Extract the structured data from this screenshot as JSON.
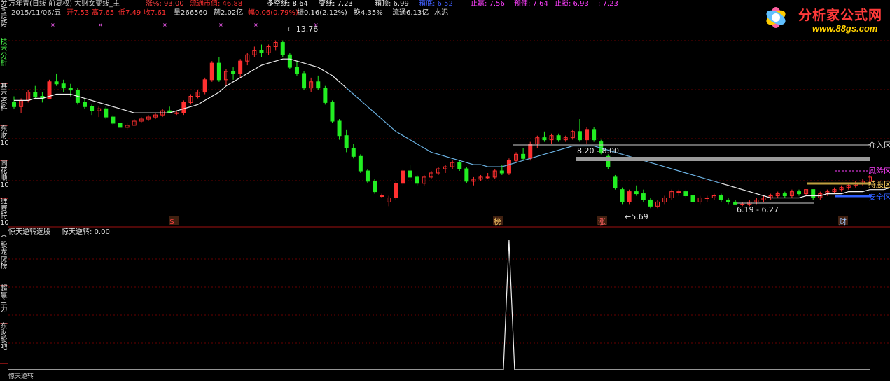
{
  "sidebar": {
    "tabs": [
      {
        "label": "分时走势",
        "active": false
      },
      {
        "label": "技术分析",
        "active": true
      },
      {
        "label": "基本资料",
        "active": false
      },
      {
        "label": "东财10",
        "active": false
      },
      {
        "label": "同花顺10",
        "active": false
      },
      {
        "label": "维赛特10",
        "active": false
      },
      {
        "label": "个股龙虎榜",
        "active": false
      },
      {
        "label": "超赢主力",
        "active": false
      },
      {
        "label": "东财股吧",
        "active": false
      }
    ]
  },
  "header": {
    "title": "万年青(日线 前复权) 大财女变线_主",
    "zhangpct": "涨%: 93.00",
    "liutong_value": "流通市值: 46.88",
    "duokong": "多空线: 8.64",
    "bianxian": "变线: 7.23",
    "xiangding": "箱顶: 6.99",
    "xiangdi": "箱底: 6.52",
    "zhiying": "止赢: 7.56",
    "yuli": "预俚: 7.64",
    "zhisun": "止损: 6.93",
    "extra": ": 7.23"
  },
  "info_row": {
    "date": "2015/11/06/五",
    "open": "开7.53",
    "high": "高7.65",
    "low": "低7.49",
    "close": "收7.61",
    "volume": "量266560",
    "amount": "额2.02亿",
    "change": "幅0.06(0.79%)",
    "amplitude": "振0.16(2.12%)",
    "turnover": "换4.35%",
    "float_cap": "流通6.13亿",
    "sector": "水泥"
  },
  "annotations": {
    "peak_label": "13.76",
    "box_label": "8.20 - 8.00",
    "low_label": "5.69",
    "range_label": "6.19 - 6.27",
    "entry": "介入区",
    "risk": "风险区",
    "hold": "持股区",
    "safe": "安全区"
  },
  "event_markers": [
    {
      "text": "$",
      "color": "#ff4040"
    },
    {
      "text": "榜",
      "color": "#f0c060"
    },
    {
      "text": "涨",
      "color": "#ff6060"
    },
    {
      "text": "财",
      "color": "#a0c8ff"
    }
  ],
  "sub_panel": {
    "title": "惊天逆转选股",
    "indicator": "惊天逆转: 0.00",
    "bottom_text": "惊天逆转"
  },
  "logo": {
    "title": "分析家公式网",
    "url": "www.88gs.com"
  },
  "colors": {
    "up": "#ff3030",
    "down": "#22ee22",
    "grid": "#6a0000",
    "ma": "#f0f0f0",
    "ma_cool": "#6ab0e0"
  },
  "chart_data": {
    "type": "candlestick",
    "candles": [
      {
        "o": 10.8,
        "h": 11.1,
        "l": 10.5,
        "c": 10.6
      },
      {
        "o": 10.6,
        "h": 11.0,
        "l": 10.3,
        "c": 10.9
      },
      {
        "o": 10.9,
        "h": 11.4,
        "l": 10.8,
        "c": 11.3
      },
      {
        "o": 11.3,
        "h": 11.6,
        "l": 11.0,
        "c": 11.1
      },
      {
        "o": 11.1,
        "h": 11.3,
        "l": 10.8,
        "c": 11.0
      },
      {
        "o": 11.0,
        "h": 11.9,
        "l": 11.0,
        "c": 11.8
      },
      {
        "o": 11.8,
        "h": 12.2,
        "l": 11.6,
        "c": 11.7
      },
      {
        "o": 11.7,
        "h": 11.9,
        "l": 11.3,
        "c": 11.5
      },
      {
        "o": 11.5,
        "h": 11.7,
        "l": 11.1,
        "c": 11.4
      },
      {
        "o": 11.4,
        "h": 11.5,
        "l": 10.7,
        "c": 10.8
      },
      {
        "o": 10.8,
        "h": 11.0,
        "l": 10.5,
        "c": 10.6
      },
      {
        "o": 10.6,
        "h": 10.7,
        "l": 10.2,
        "c": 10.4
      },
      {
        "o": 10.4,
        "h": 10.6,
        "l": 10.1,
        "c": 10.5
      },
      {
        "o": 10.5,
        "h": 10.6,
        "l": 10.0,
        "c": 10.1
      },
      {
        "o": 10.1,
        "h": 10.2,
        "l": 9.7,
        "c": 9.8
      },
      {
        "o": 9.8,
        "h": 9.9,
        "l": 9.5,
        "c": 9.6
      },
      {
        "o": 9.6,
        "h": 9.8,
        "l": 9.5,
        "c": 9.7
      },
      {
        "o": 9.7,
        "h": 10.0,
        "l": 9.7,
        "c": 9.9
      },
      {
        "o": 9.9,
        "h": 10.1,
        "l": 9.8,
        "c": 10.0
      },
      {
        "o": 10.0,
        "h": 10.2,
        "l": 9.9,
        "c": 10.1
      },
      {
        "o": 10.1,
        "h": 10.3,
        "l": 10.0,
        "c": 10.2
      },
      {
        "o": 10.2,
        "h": 10.5,
        "l": 10.1,
        "c": 10.4
      },
      {
        "o": 10.4,
        "h": 10.6,
        "l": 10.3,
        "c": 10.3
      },
      {
        "o": 10.3,
        "h": 10.4,
        "l": 10.2,
        "c": 10.3
      },
      {
        "o": 10.3,
        "h": 10.9,
        "l": 10.2,
        "c": 10.8
      },
      {
        "o": 10.8,
        "h": 11.2,
        "l": 10.7,
        "c": 11.1
      },
      {
        "o": 11.1,
        "h": 11.4,
        "l": 11.0,
        "c": 11.3
      },
      {
        "o": 11.3,
        "h": 12.0,
        "l": 11.2,
        "c": 11.9
      },
      {
        "o": 11.9,
        "h": 12.8,
        "l": 11.8,
        "c": 12.7
      },
      {
        "o": 12.7,
        "h": 13.0,
        "l": 11.8,
        "c": 11.9
      },
      {
        "o": 11.9,
        "h": 12.4,
        "l": 11.6,
        "c": 12.3
      },
      {
        "o": 12.3,
        "h": 12.5,
        "l": 11.9,
        "c": 12.2
      },
      {
        "o": 12.2,
        "h": 12.9,
        "l": 12.0,
        "c": 12.8
      },
      {
        "o": 12.8,
        "h": 13.2,
        "l": 12.6,
        "c": 13.1
      },
      {
        "o": 13.1,
        "h": 13.5,
        "l": 13.0,
        "c": 13.3
      },
      {
        "o": 13.3,
        "h": 13.6,
        "l": 13.0,
        "c": 13.2
      },
      {
        "o": 13.2,
        "h": 13.6,
        "l": 13.1,
        "c": 13.5
      },
      {
        "o": 13.5,
        "h": 13.8,
        "l": 13.3,
        "c": 13.7
      },
      {
        "o": 13.7,
        "h": 13.8,
        "l": 13.0,
        "c": 13.1
      },
      {
        "o": 13.1,
        "h": 13.2,
        "l": 12.4,
        "c": 12.5
      },
      {
        "o": 12.5,
        "h": 12.8,
        "l": 12.1,
        "c": 12.2
      },
      {
        "o": 12.2,
        "h": 12.3,
        "l": 11.4,
        "c": 11.5
      },
      {
        "o": 11.5,
        "h": 12.0,
        "l": 11.3,
        "c": 11.8
      },
      {
        "o": 11.8,
        "h": 12.1,
        "l": 11.4,
        "c": 11.5
      },
      {
        "o": 11.5,
        "h": 11.6,
        "l": 10.7,
        "c": 10.8
      },
      {
        "o": 10.8,
        "h": 10.9,
        "l": 9.8,
        "c": 9.9
      },
      {
        "o": 9.9,
        "h": 10.0,
        "l": 9.0,
        "c": 9.2
      },
      {
        "o": 9.2,
        "h": 9.5,
        "l": 8.4,
        "c": 8.6
      },
      {
        "o": 8.6,
        "h": 8.8,
        "l": 8.1,
        "c": 8.2
      },
      {
        "o": 8.2,
        "h": 8.3,
        "l": 7.4,
        "c": 7.5
      },
      {
        "o": 7.5,
        "h": 7.6,
        "l": 6.9,
        "c": 7.0
      },
      {
        "o": 7.0,
        "h": 7.1,
        "l": 6.4,
        "c": 6.5
      },
      {
        "o": 6.3,
        "h": 6.4,
        "l": 6.2,
        "c": 6.3
      },
      {
        "o": 6.0,
        "h": 6.3,
        "l": 5.8,
        "c": 6.2
      },
      {
        "o": 6.2,
        "h": 7.0,
        "l": 6.1,
        "c": 6.9
      },
      {
        "o": 6.9,
        "h": 7.6,
        "l": 6.8,
        "c": 7.5
      },
      {
        "o": 7.5,
        "h": 7.8,
        "l": 7.1,
        "c": 7.2
      },
      {
        "o": 7.2,
        "h": 7.3,
        "l": 6.8,
        "c": 6.9
      },
      {
        "o": 6.9,
        "h": 7.3,
        "l": 6.8,
        "c": 7.2
      },
      {
        "o": 7.2,
        "h": 7.5,
        "l": 7.1,
        "c": 7.4
      },
      {
        "o": 7.4,
        "h": 7.7,
        "l": 7.3,
        "c": 7.6
      },
      {
        "o": 7.6,
        "h": 7.8,
        "l": 7.4,
        "c": 7.7
      },
      {
        "o": 7.7,
        "h": 8.0,
        "l": 7.6,
        "c": 7.9
      },
      {
        "o": 7.9,
        "h": 8.0,
        "l": 7.5,
        "c": 7.6
      },
      {
        "o": 7.6,
        "h": 7.7,
        "l": 6.9,
        "c": 7.0
      },
      {
        "o": 7.0,
        "h": 7.2,
        "l": 6.8,
        "c": 7.1
      },
      {
        "o": 7.1,
        "h": 7.3,
        "l": 7.0,
        "c": 7.2
      },
      {
        "o": 7.2,
        "h": 7.4,
        "l": 7.1,
        "c": 7.2
      },
      {
        "o": 7.2,
        "h": 7.6,
        "l": 7.1,
        "c": 7.5
      },
      {
        "o": 7.5,
        "h": 7.8,
        "l": 7.3,
        "c": 7.4
      },
      {
        "o": 7.4,
        "h": 8.1,
        "l": 7.3,
        "c": 8.0
      },
      {
        "o": 8.0,
        "h": 8.4,
        "l": 7.9,
        "c": 8.3
      },
      {
        "o": 8.3,
        "h": 8.6,
        "l": 8.0,
        "c": 8.1
      },
      {
        "o": 8.1,
        "h": 8.9,
        "l": 8.0,
        "c": 8.8
      },
      {
        "o": 8.8,
        "h": 9.2,
        "l": 8.6,
        "c": 9.1
      },
      {
        "o": 9.1,
        "h": 9.4,
        "l": 8.9,
        "c": 9.0
      },
      {
        "o": 9.0,
        "h": 9.3,
        "l": 8.8,
        "c": 9.2
      },
      {
        "o": 9.2,
        "h": 9.3,
        "l": 8.9,
        "c": 9.0
      },
      {
        "o": 9.0,
        "h": 9.2,
        "l": 8.9,
        "c": 9.1
      },
      {
        "o": 9.1,
        "h": 9.5,
        "l": 9.0,
        "c": 9.4
      },
      {
        "o": 9.4,
        "h": 10.0,
        "l": 8.9,
        "c": 9.0
      },
      {
        "o": 9.0,
        "h": 9.6,
        "l": 8.8,
        "c": 9.5
      },
      {
        "o": 9.5,
        "h": 9.6,
        "l": 8.9,
        "c": 9.0
      },
      {
        "o": 8.9,
        "h": 9.0,
        "l": 8.3,
        "c": 8.4
      },
      {
        "o": 8.2,
        "h": 8.3,
        "l": 7.6,
        "c": 7.7
      },
      {
        "o": 7.2,
        "h": 7.3,
        "l": 6.6,
        "c": 6.7
      },
      {
        "o": 6.6,
        "h": 6.7,
        "l": 5.9,
        "c": 6.0
      },
      {
        "o": 6.0,
        "h": 6.6,
        "l": 5.9,
        "c": 6.5
      },
      {
        "o": 6.5,
        "h": 6.8,
        "l": 6.3,
        "c": 6.4
      },
      {
        "o": 6.4,
        "h": 6.6,
        "l": 6.0,
        "c": 6.1
      },
      {
        "o": 6.1,
        "h": 6.2,
        "l": 5.7,
        "c": 5.8
      },
      {
        "o": 5.8,
        "h": 6.1,
        "l": 5.7,
        "c": 6.0
      },
      {
        "o": 6.0,
        "h": 6.3,
        "l": 5.9,
        "c": 6.2
      },
      {
        "o": 6.2,
        "h": 6.6,
        "l": 6.1,
        "c": 6.5
      },
      {
        "o": 6.5,
        "h": 6.6,
        "l": 6.3,
        "c": 6.5
      },
      {
        "o": 6.5,
        "h": 6.6,
        "l": 6.2,
        "c": 6.3
      },
      {
        "o": 6.3,
        "h": 6.4,
        "l": 5.9,
        "c": 6.0
      },
      {
        "o": 6.0,
        "h": 6.3,
        "l": 5.9,
        "c": 6.2
      },
      {
        "o": 6.2,
        "h": 6.3,
        "l": 6.0,
        "c": 6.2
      },
      {
        "o": 6.2,
        "h": 6.4,
        "l": 6.1,
        "c": 6.3
      },
      {
        "o": 6.3,
        "h": 6.4,
        "l": 6.0,
        "c": 6.1
      },
      {
        "o": 6.1,
        "h": 6.2,
        "l": 5.9,
        "c": 6.0
      },
      {
        "o": 6.0,
        "h": 6.1,
        "l": 5.9,
        "c": 5.9
      },
      {
        "o": 5.9,
        "h": 6.0,
        "l": 5.8,
        "c": 5.9
      },
      {
        "o": 5.9,
        "h": 6.1,
        "l": 5.8,
        "c": 6.0
      },
      {
        "o": 6.0,
        "h": 6.2,
        "l": 5.9,
        "c": 6.1
      },
      {
        "o": 6.1,
        "h": 6.3,
        "l": 6.0,
        "c": 6.2
      },
      {
        "o": 6.2,
        "h": 6.4,
        "l": 6.1,
        "c": 6.3
      },
      {
        "o": 6.3,
        "h": 6.5,
        "l": 6.2,
        "c": 6.4
      },
      {
        "o": 6.4,
        "h": 6.5,
        "l": 6.2,
        "c": 6.3
      },
      {
        "o": 6.3,
        "h": 6.6,
        "l": 6.2,
        "c": 6.5
      },
      {
        "o": 6.5,
        "h": 6.6,
        "l": 6.3,
        "c": 6.4
      },
      {
        "o": 6.4,
        "h": 6.6,
        "l": 6.3,
        "c": 6.6
      },
      {
        "o": 6.6,
        "h": 6.6,
        "l": 6.1,
        "c": 6.2
      },
      {
        "o": 6.2,
        "h": 6.5,
        "l": 6.1,
        "c": 6.4
      },
      {
        "o": 6.4,
        "h": 6.6,
        "l": 6.3,
        "c": 6.5
      },
      {
        "o": 6.5,
        "h": 6.7,
        "l": 6.4,
        "c": 6.6
      },
      {
        "o": 6.6,
        "h": 6.8,
        "l": 6.5,
        "c": 6.7
      },
      {
        "o": 6.7,
        "h": 6.9,
        "l": 6.6,
        "c": 6.8
      },
      {
        "o": 6.8,
        "h": 7.0,
        "l": 6.7,
        "c": 6.9
      },
      {
        "o": 6.9,
        "h": 7.1,
        "l": 6.8,
        "c": 7.0
      },
      {
        "o": 7.0,
        "h": 7.3,
        "l": 6.9,
        "c": 7.2
      }
    ],
    "ma": [
      10.9,
      10.9,
      10.9,
      11.0,
      11.0,
      11.1,
      11.2,
      11.2,
      11.2,
      11.1,
      11.0,
      10.9,
      10.8,
      10.7,
      10.6,
      10.5,
      10.4,
      10.3,
      10.3,
      10.3,
      10.3,
      10.3,
      10.3,
      10.4,
      10.5,
      10.6,
      10.7,
      10.9,
      11.1,
      11.3,
      11.6,
      11.8,
      12.0,
      12.2,
      12.4,
      12.6,
      12.7,
      12.8,
      12.9,
      12.9,
      12.8,
      12.7,
      12.6,
      12.5,
      12.3,
      12.1,
      11.8,
      11.5,
      11.2,
      10.9,
      10.6,
      10.3,
      10.0,
      9.7,
      9.4,
      9.2,
      9.0,
      8.8,
      8.6,
      8.4,
      8.3,
      8.2,
      8.1,
      8.0,
      7.9,
      7.8,
      7.8,
      7.7,
      7.7,
      7.7,
      7.8,
      7.9,
      8.0,
      8.1,
      8.2,
      8.3,
      8.4,
      8.5,
      8.6,
      8.7,
      8.7,
      8.7,
      8.7,
      8.6,
      8.5,
      8.4,
      8.3,
      8.2,
      8.1,
      8.0,
      7.9,
      7.8,
      7.7,
      7.6,
      7.5,
      7.4,
      7.3,
      7.2,
      7.1,
      7.0,
      6.9,
      6.8,
      6.7,
      6.6,
      6.5,
      6.4,
      6.3,
      6.2,
      6.2,
      6.2,
      6.2,
      6.2,
      6.3,
      6.3,
      6.3,
      6.4,
      6.4,
      6.4,
      6.5,
      6.5,
      6.5,
      6.6,
      6.6,
      6.6,
      6.7
    ],
    "signal_index": 70,
    "ylim": [
      5.0,
      14.8
    ]
  }
}
